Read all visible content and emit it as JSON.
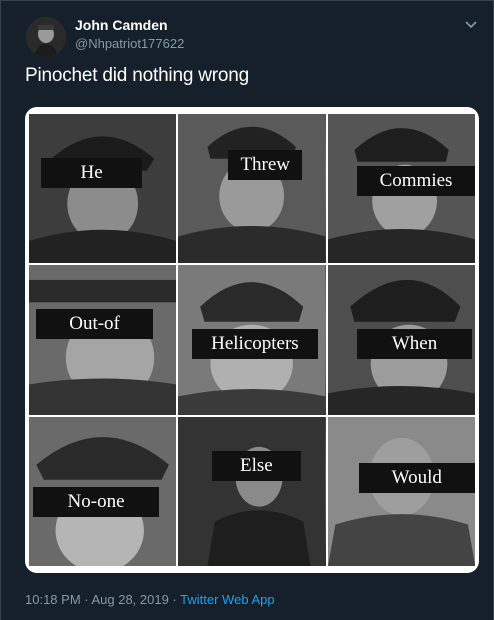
{
  "tweet": {
    "display_name": "John Camden",
    "handle": "@Nhpatriot177622",
    "text": "Pinochet did nothing wrong",
    "timestamp": "10:18 PM · Aug 28, 2019 · ",
    "source": "Twitter Web App",
    "menu_icon": "chevron-down-icon",
    "avatar_icon": "avatar"
  },
  "meme": {
    "captions": [
      "He",
      "Threw",
      "Commies",
      "Out-of",
      "Helicopters",
      "When",
      "No-one",
      "Else",
      "Would"
    ]
  },
  "colors": {
    "background": "#15202b",
    "muted_text": "#8899a6",
    "accent": "#1da1f2",
    "border": "#38444d"
  }
}
